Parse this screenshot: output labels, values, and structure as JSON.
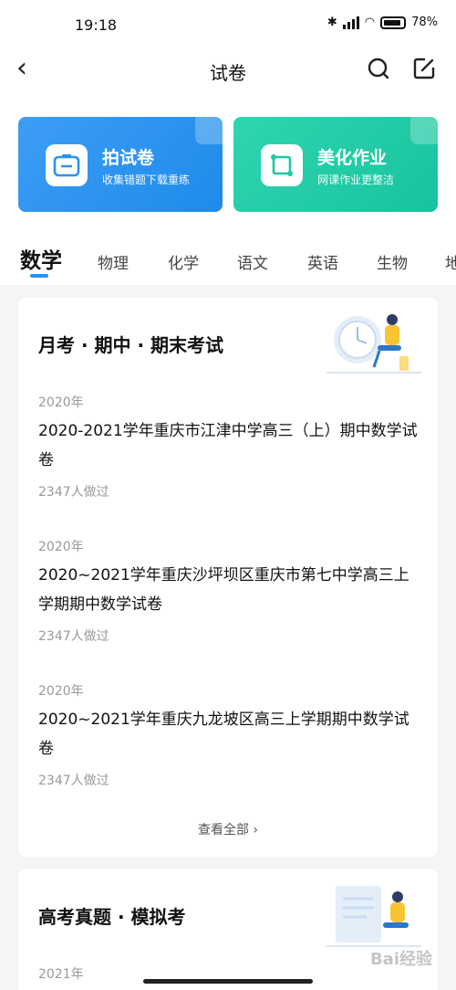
{
  "status": {
    "time": "19:18",
    "battery": "78%"
  },
  "nav": {
    "title": "试卷"
  },
  "hero": {
    "cards": [
      {
        "title": "拍试卷",
        "subtitle": "收集错题下载重练",
        "color": "#2a93ef"
      },
      {
        "title": "美化作业",
        "subtitle": "网课作业更整洁",
        "color": "#1ec9a3"
      }
    ]
  },
  "tabs": [
    "数学",
    "物理",
    "化学",
    "语文",
    "英语",
    "生物",
    "地"
  ],
  "section1": {
    "title": "月考 · 期中 · 期末考试",
    "papers": [
      {
        "year": "2020年",
        "title": "2020-2021学年重庆市江津中学高三（上）期中数学试卷",
        "count": "2347人做过"
      },
      {
        "year": "2020年",
        "title": "2020~2021学年重庆沙坪坝区重庆市第七中学高三上学期期中数学试卷",
        "count": "2347人做过"
      },
      {
        "year": "2020年",
        "title": "2020~2021学年重庆九龙坡区高三上学期期中数学试卷",
        "count": "2347人做过"
      }
    ],
    "view_all": "查看全部 ›"
  },
  "section2": {
    "title": "高考真题 · 模拟考",
    "year_peek": "2021年"
  },
  "watermark": "Bai经验",
  "accent_color": "#2196f3"
}
